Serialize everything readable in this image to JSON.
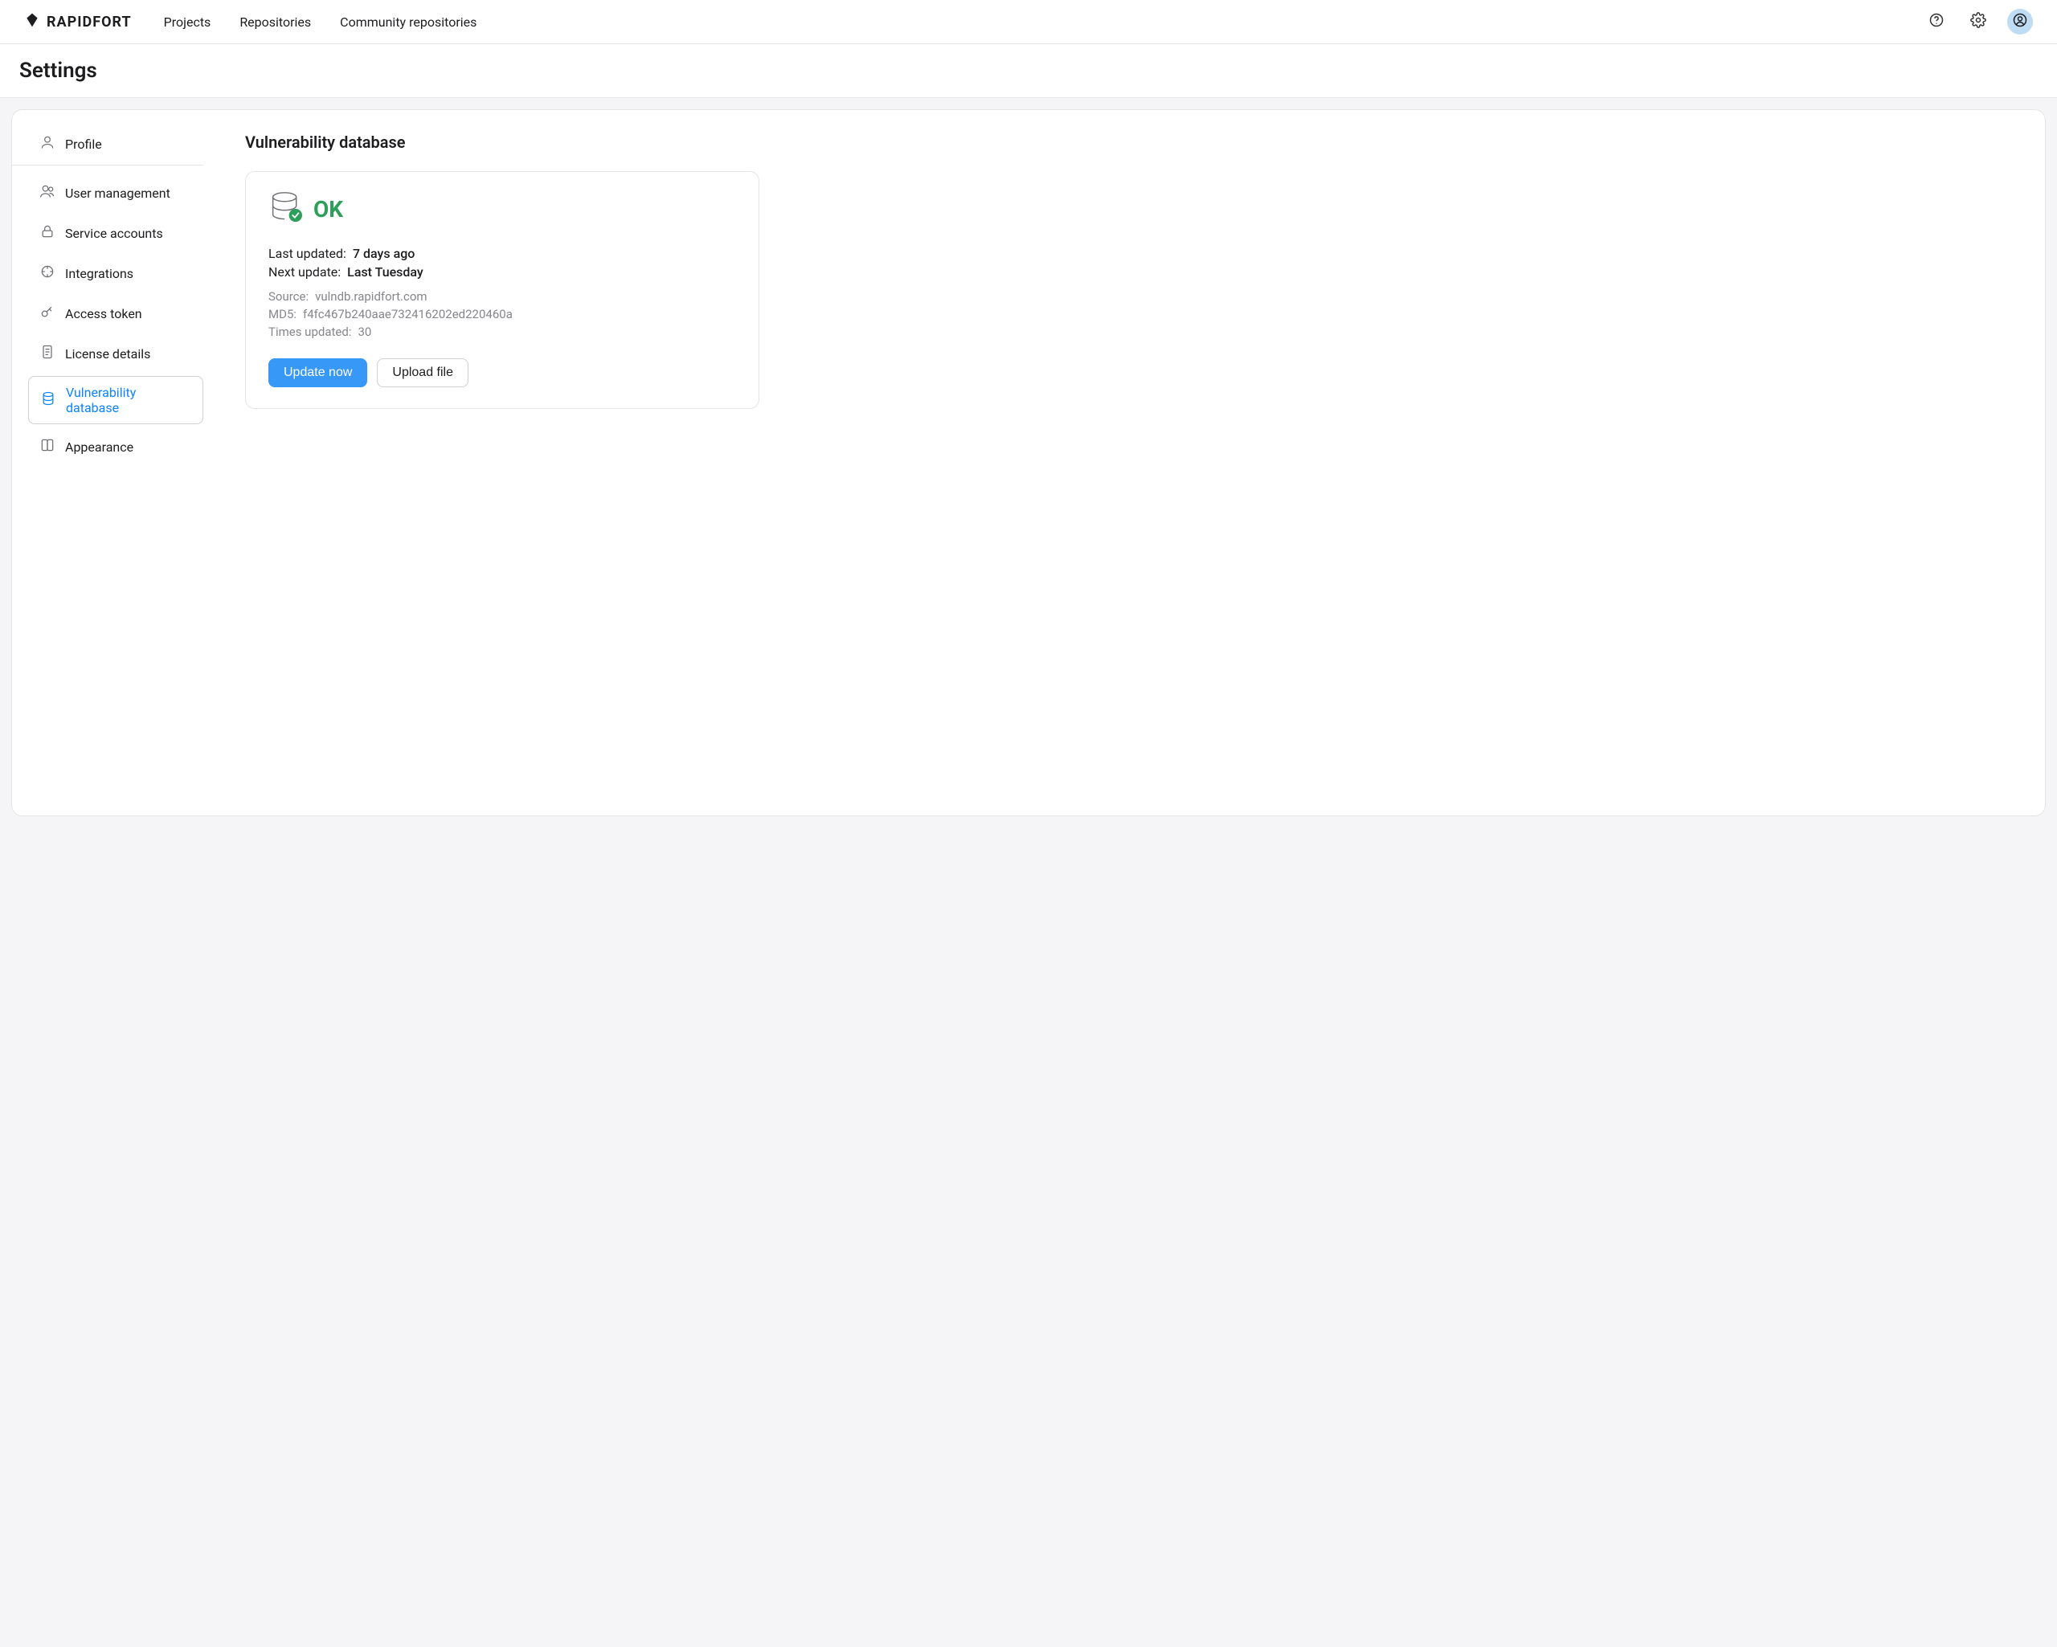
{
  "brand": "RAPIDFORT",
  "nav": {
    "projects": "Projects",
    "repositories": "Repositories",
    "community": "Community repositories"
  },
  "page_title": "Settings",
  "sidebar": {
    "profile": "Profile",
    "user_management": "User management",
    "service_accounts": "Service accounts",
    "integrations": "Integrations",
    "access_token": "Access token",
    "license_details": "License details",
    "vulnerability_database": "Vulnerability database",
    "appearance": "Appearance"
  },
  "section": {
    "title": "Vulnerability database",
    "status": "OK",
    "last_updated_label": "Last updated:",
    "last_updated_value": "7 days ago",
    "next_update_label": "Next update:",
    "next_update_value": "Last Tuesday",
    "source_label": "Source:",
    "source_value": "vulndb.rapidfort.com",
    "md5_label": "MD5:",
    "md5_value": "f4fc467b240aae732416202ed220460a",
    "times_updated_label": "Times updated:",
    "times_updated_value": "30",
    "update_now": "Update now",
    "upload_file": "Upload file"
  }
}
